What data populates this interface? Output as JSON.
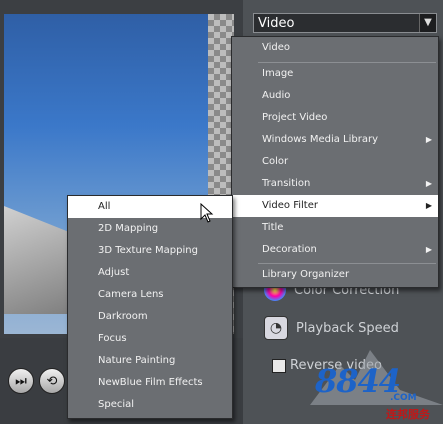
{
  "dropdown": {
    "value": "Video"
  },
  "main_menu": [
    {
      "label": "Video",
      "submenu": false
    },
    {
      "label": "Image",
      "submenu": false
    },
    {
      "label": "Audio",
      "submenu": false
    },
    {
      "label": "Project Video",
      "submenu": false
    },
    {
      "label": "Windows Media Library",
      "submenu": true
    },
    {
      "label": "Color",
      "submenu": false
    },
    {
      "label": "Transition",
      "submenu": true
    },
    {
      "label": "Video Filter",
      "submenu": true,
      "selected": true
    },
    {
      "label": "Title",
      "submenu": false
    },
    {
      "label": "Decoration",
      "submenu": true
    },
    {
      "label": "Library Organizer",
      "submenu": false
    }
  ],
  "filter_submenu": [
    "All",
    "2D Mapping",
    "3D Texture Mapping",
    "Adjust",
    "Camera Lens",
    "Darkroom",
    "Focus",
    "Nature Painting",
    "NewBlue Film Effects",
    "Special"
  ],
  "panel": {
    "color_correction": "Color Correction",
    "playback_speed": "Playback Speed",
    "reverse_video": "Reverse video"
  },
  "watermark": {
    "number": "8844",
    "domain": ".COM",
    "tagline": "连邦服务"
  },
  "icons": {
    "submenu_arrow": "▶",
    "dropdown_arrow": "▼"
  }
}
